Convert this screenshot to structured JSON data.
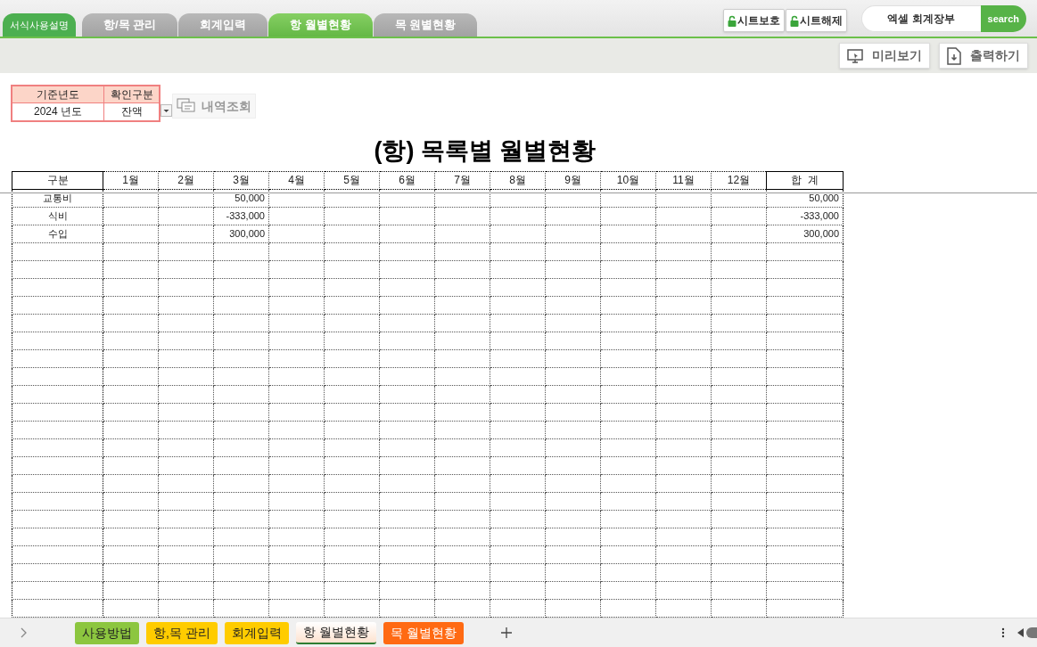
{
  "top_tabs": [
    {
      "label": "서식사용설명",
      "kind": "guide"
    },
    {
      "label": "항/목 관리",
      "kind": "sheet",
      "selected": false
    },
    {
      "label": "회계입력",
      "kind": "sheet",
      "selected": false
    },
    {
      "label": "항 월별현황",
      "kind": "sheet",
      "selected": true
    },
    {
      "label": "목 원별현황",
      "kind": "sheet",
      "selected": false
    }
  ],
  "protect_buttons": [
    "시트보호",
    "시트해제"
  ],
  "search": {
    "value": "엑셀 회계장부",
    "button": "search"
  },
  "toolbar_buttons": [
    {
      "label": "미리보기",
      "kind": "preview"
    },
    {
      "label": "출력하기",
      "kind": "print"
    }
  ],
  "filter": {
    "headers": [
      "기준년도",
      "확인구분"
    ],
    "year": "2024 년도",
    "type": "잔액",
    "query_button": "내역조회"
  },
  "title": "(항) 목록별 월별현황",
  "table": {
    "columns": [
      "구분",
      "1월",
      "2월",
      "3월",
      "4월",
      "5월",
      "6월",
      "7월",
      "8월",
      "9월",
      "10월",
      "11월",
      "12월",
      "합  계"
    ],
    "rows": [
      {
        "label": "교통비",
        "month_3": "50,000",
        "total": "50,000"
      },
      {
        "label": "식비",
        "month_3": "-333,000",
        "total": "-333,000"
      },
      {
        "label": "수입",
        "month_3": "300,000",
        "total": "300,000"
      }
    ]
  },
  "sheet_tabs": [
    {
      "label": "사용방법",
      "color": "#8cc63f",
      "selected": false
    },
    {
      "label": "항,목 관리",
      "color": "#ffcc00",
      "selected": false
    },
    {
      "label": "회계입력",
      "color": "#ffcc00",
      "selected": false
    },
    {
      "label": "항 월별현황",
      "color": "#fde2cf",
      "selected": true
    },
    {
      "label": "목 월별현황",
      "color": "#ff6a13",
      "selected": false
    }
  ]
}
